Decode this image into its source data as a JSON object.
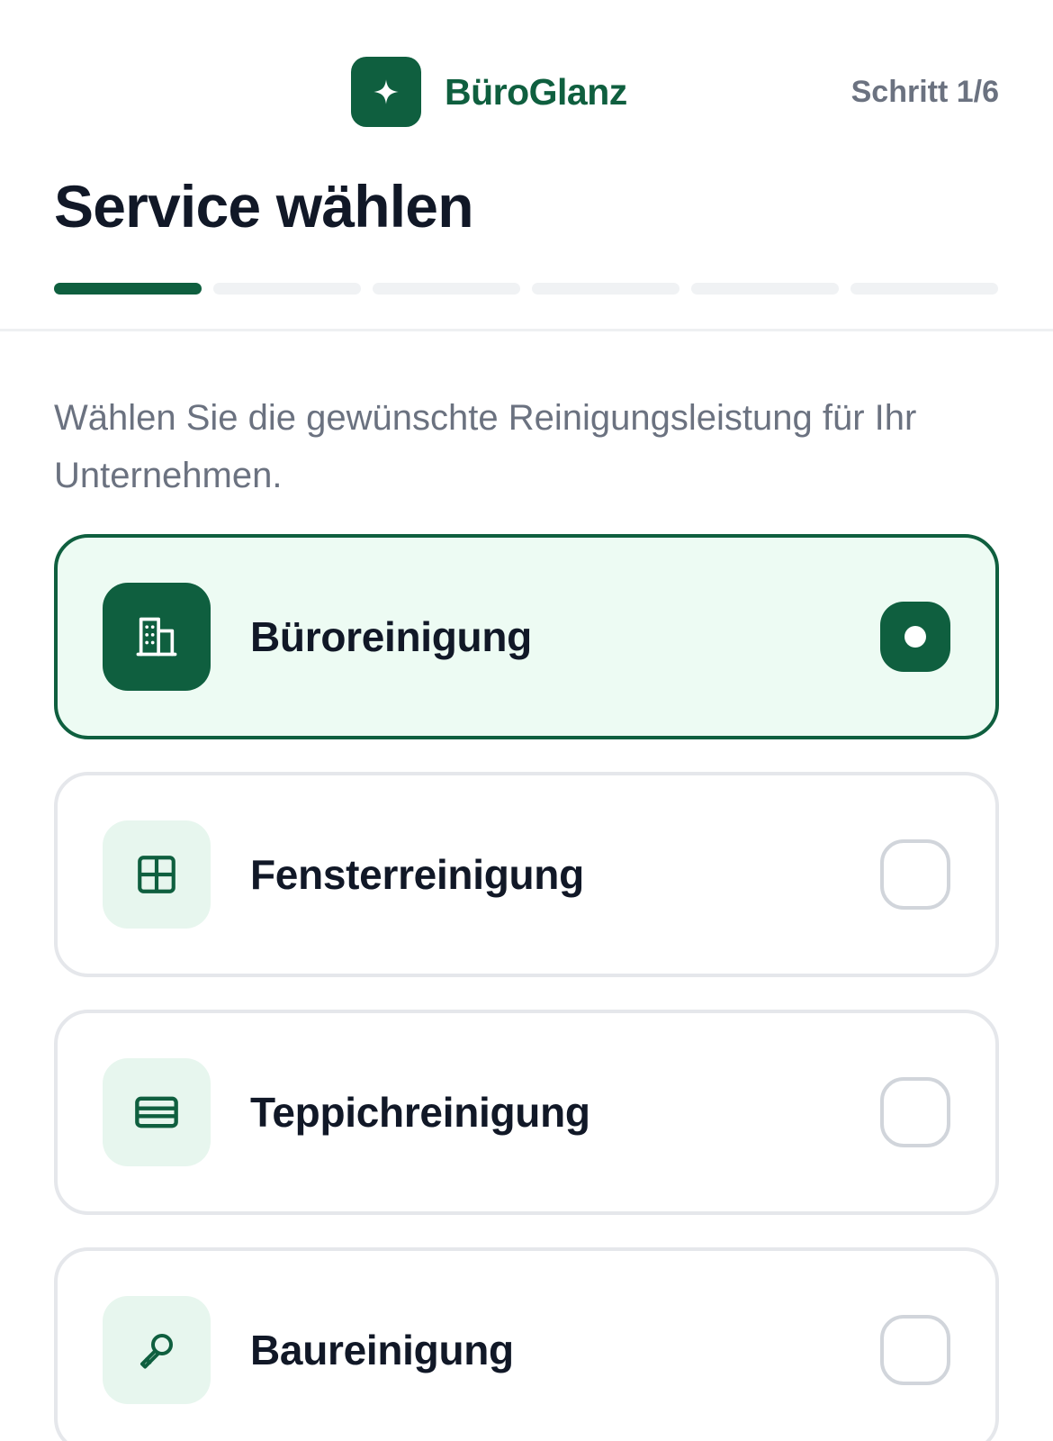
{
  "header": {
    "brand_name": "BüroGlanz",
    "brand_icon": "sparkle-icon",
    "step_label": "Schritt 1/6",
    "title": "Service wählen",
    "progress": {
      "current_step": 1,
      "total_steps": 6
    }
  },
  "intro": "Wählen Sie die gewünschte Reinigungsleistung für Ihr Unternehmen.",
  "options": [
    {
      "label": "Büroreinigung",
      "icon": "building-icon",
      "selected": true
    },
    {
      "label": "Fensterreinigung",
      "icon": "window-icon",
      "selected": false
    },
    {
      "label": "Teppichreinigung",
      "icon": "carpet-icon",
      "selected": false
    },
    {
      "label": "Baureinigung",
      "icon": "wrench-icon",
      "selected": false
    }
  ],
  "colors": {
    "brand": "#0f5f3f",
    "selected_background": "#edfbf3",
    "icon_tile": "#e7f6ee",
    "muted_text": "#6b7280",
    "border": "#e5e7eb"
  }
}
